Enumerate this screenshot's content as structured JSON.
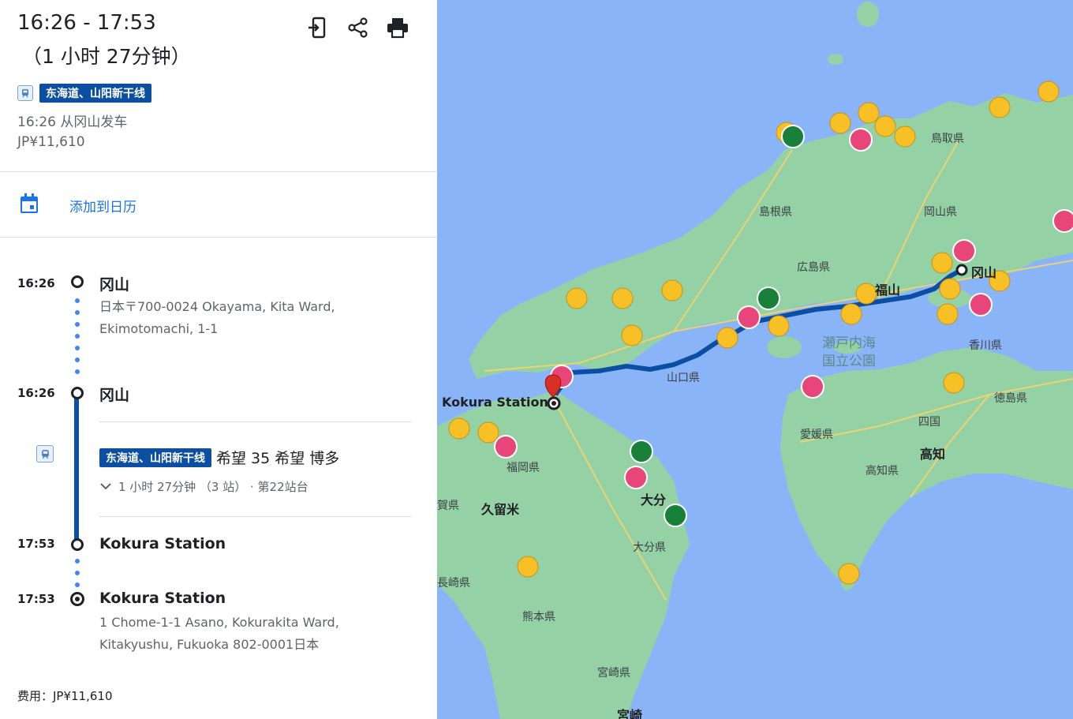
{
  "header": {
    "time_range": "16:26 - 17:53",
    "duration": "（1 小时 27分钟）",
    "icons": [
      "send-to-phone-icon",
      "share-icon",
      "print-icon"
    ]
  },
  "summary": {
    "line_name": "东海道、山阳新干线",
    "departure": "16:26 从冈山发车",
    "fare": "JP¥11,610"
  },
  "calendar": {
    "label": "添加到日历"
  },
  "timeline": {
    "start": {
      "time": "16:26",
      "name": "冈山",
      "address_line1": "日本〒700-0024 Okayama, Kita Ward,",
      "address_line2": "Ekimotomachi, 1-1"
    },
    "board": {
      "time": "16:26",
      "name": "冈山"
    },
    "train": {
      "line_name": "东海道、山阳新干线",
      "service": "希望 35 希望 博多",
      "details": "1 小时 27分钟 （3 站） · 第22站台"
    },
    "alight": {
      "time": "17:53",
      "name": "Kokura Station"
    },
    "end": {
      "time": "17:53",
      "name": "Kokura Station",
      "address_line1": "1 Chome-1-1 Asano, Kokurakita Ward,",
      "address_line2": "Kitakyushu, Fukuoka 802-0001日本"
    }
  },
  "cost": "费用：JP¥11,610",
  "map": {
    "labels": {
      "okayama": "冈山",
      "kokura": "Kokura Station",
      "tottori": "鳥取県",
      "shimane": "島根県",
      "okayama_pref": "岡山県",
      "hiroshima": "広島県",
      "fukuyama": "福山",
      "setonaikai": "瀬戸内海",
      "kokuritsu": "国立公園",
      "yamaguchi": "山口県",
      "kagawa": "香川県",
      "tokushima": "徳島県",
      "shikoku": "四国",
      "ehime": "愛媛県",
      "kochi": "高知",
      "kochi_pref": "高知県",
      "fukuoka": "福岡県",
      "kurume": "久留米",
      "oita": "大分",
      "oita_pref": "大分県",
      "nagasaki": "長崎県",
      "kumamoto": "熊本県",
      "miyazaki_pref": "宮崎県",
      "miyazaki": "宮崎",
      "saga": "賀県"
    },
    "colors": {
      "water": "#8ab4f8",
      "land": "#94d2a5",
      "route": "#0b4ea2",
      "star": "#f6c026",
      "heart": "#e8457a",
      "flag": "#188038"
    }
  }
}
